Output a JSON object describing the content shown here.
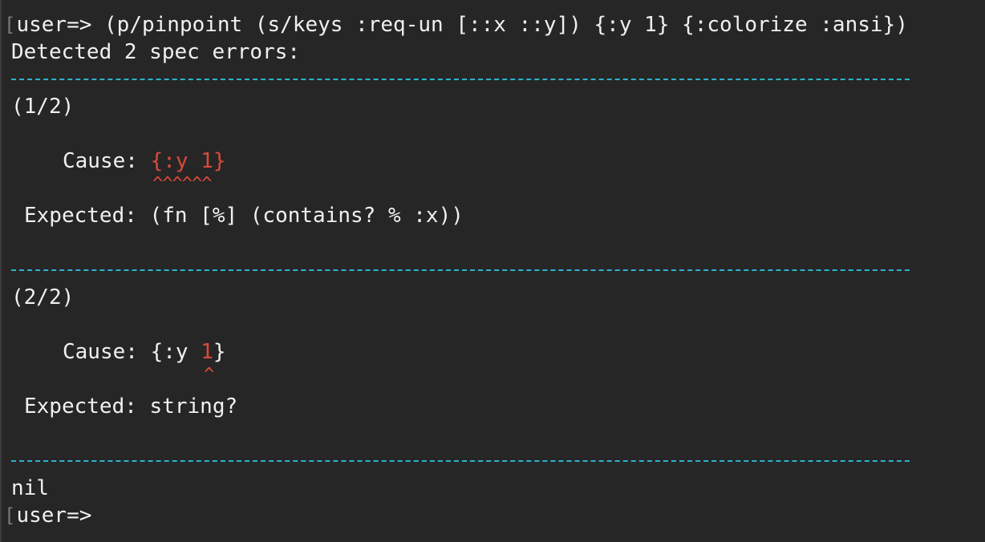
{
  "terminal": {
    "prompt": "user=>",
    "command": " (p/pinpoint (s/keys :req-un [::x ::y]) {:y 1} {:colorize :ansi})",
    "summary": "Detected 2 spec errors:",
    "errors": [
      {
        "index": "(1/2)",
        "cause_label": "Cause: ",
        "cause_value": "{:y 1}",
        "marker": "^^^^^^",
        "expected_label": "Expected: ",
        "expected_value": "(fn [%] (contains? % :x))"
      },
      {
        "index": "(2/2)",
        "cause_label": "Cause: ",
        "cause_prefix": "{:y ",
        "cause_highlight": "1",
        "cause_suffix": "}",
        "marker": "^",
        "expected_label": "Expected: ",
        "expected_value": "string?"
      }
    ],
    "result": "nil",
    "final_prompt": "user=>"
  },
  "colors": {
    "background": "#262626",
    "text": "#f0f0f0",
    "error": "#d94a3a",
    "separator": "#2bb3cf"
  }
}
